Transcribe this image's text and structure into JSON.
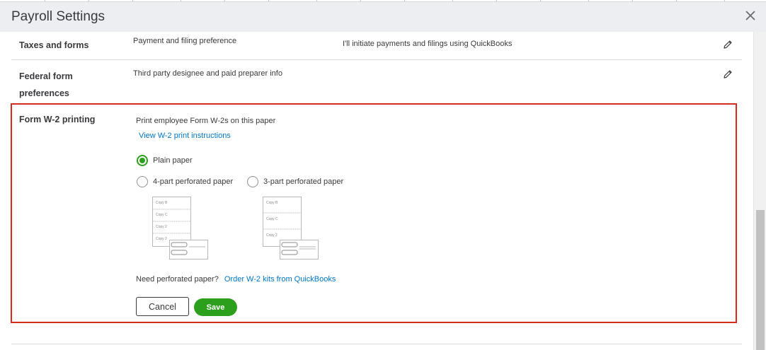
{
  "header": {
    "title": "Payroll Settings",
    "close_icon": "close-icon"
  },
  "rows": [
    {
      "label": "Taxes and forms",
      "description": "Payment and filing preference",
      "value": "I'll initiate payments and filings using QuickBooks",
      "action_icon": "pencil-icon"
    },
    {
      "label_line1": "Federal form",
      "label_line2": "preferences",
      "description": "Third party designee and paid preparer info",
      "action_icon": "pencil-icon"
    }
  ],
  "w2": {
    "label": "Form W-2 printing",
    "description": "Print employee Form W-2s on this paper",
    "instructions_link": "View W-2 print instructions",
    "options": [
      {
        "label": "Plain paper",
        "checked": true
      },
      {
        "label": "4-part perforated paper",
        "checked": false
      },
      {
        "label": "3-part perforated paper",
        "checked": false
      }
    ],
    "four_part_copies": [
      "Copy B",
      "Copy C",
      "Copy 2",
      "Copy 2"
    ],
    "three_part_copies": [
      "Copy B",
      "Copy C",
      "Copy 2"
    ],
    "need_text": "Need perforated paper?",
    "order_link": "Order W-2 kits from QuickBooks",
    "cancel_label": "Cancel",
    "save_label": "Save"
  },
  "colors": {
    "accent_green": "#2ca01c",
    "link_blue": "#0077c5",
    "highlight_red": "#d52b1e",
    "header_bg": "#eceef1"
  }
}
